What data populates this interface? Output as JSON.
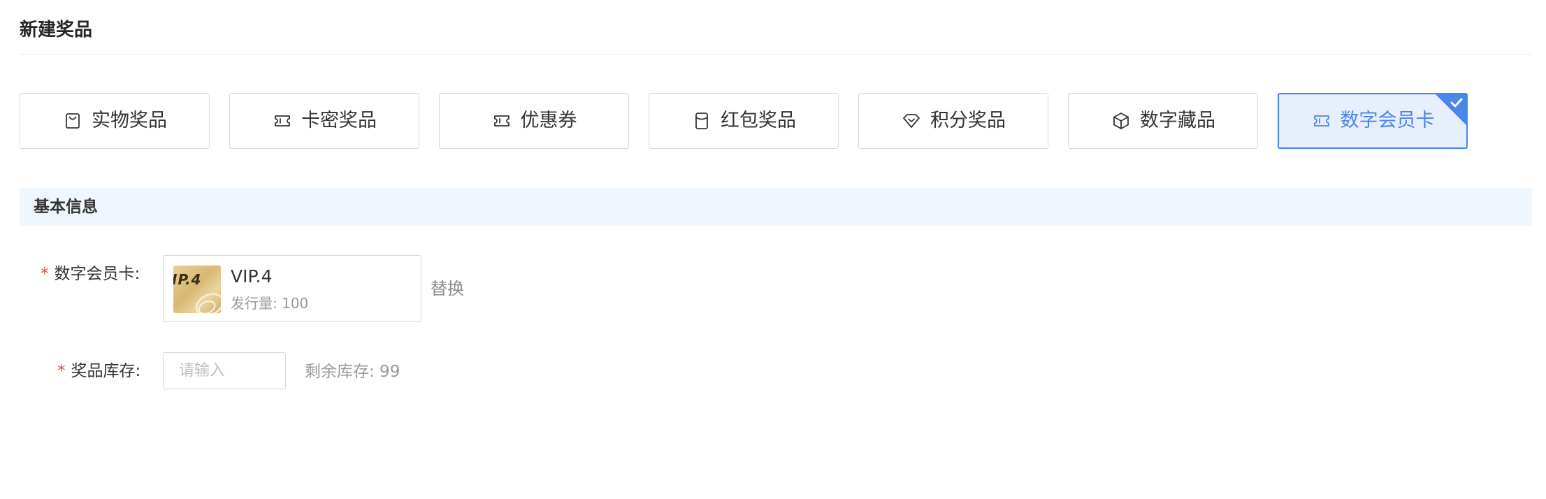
{
  "page": {
    "title": "新建奖品"
  },
  "prize_types": [
    {
      "label": "实物奖品",
      "icon": "shopping-bag-icon",
      "selected": false
    },
    {
      "label": "卡密奖品",
      "icon": "ticket-icon",
      "selected": false
    },
    {
      "label": "优惠券",
      "icon": "coupon-icon",
      "selected": false
    },
    {
      "label": "红包奖品",
      "icon": "red-envelope-icon",
      "selected": false
    },
    {
      "label": "积分奖品",
      "icon": "diamond-icon",
      "selected": false
    },
    {
      "label": "数字藏品",
      "icon": "cube-icon",
      "selected": false
    },
    {
      "label": "数字会员卡",
      "icon": "member-card-icon",
      "selected": true
    }
  ],
  "section": {
    "title": "基本信息"
  },
  "form": {
    "required_mark": "*",
    "member_card": {
      "label": "数字会员卡:",
      "card_name": "VIP.4",
      "thumb_text": "IP.4",
      "issue_text": "发行量: 100",
      "replace_label": "替换"
    },
    "stock": {
      "label": "奖品库存:",
      "value": "",
      "placeholder": "请输入",
      "remaining_text": "剩余库存: 99"
    }
  },
  "colors": {
    "accent": "#4a86e8",
    "selected_bg": "#e7effc",
    "section_bg": "#f0f6fe",
    "required": "#e5503f",
    "muted_text": "#999999",
    "border": "#d9d9d9"
  }
}
